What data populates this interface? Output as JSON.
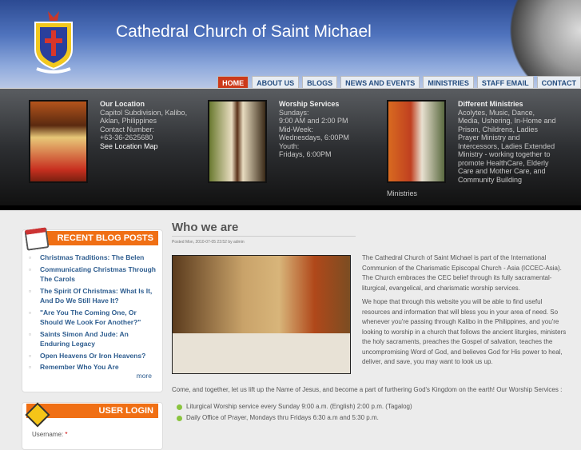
{
  "header": {
    "title": "Cathedral Church of Saint Michael"
  },
  "nav": [
    "HOME",
    "ABOUT US",
    "BLOGS",
    "NEWS AND EVENTS",
    "MINISTRIES",
    "STAFF EMAIL",
    "CONTACT"
  ],
  "features": [
    {
      "title": "Our Location",
      "lines": [
        "Capitol Subdivision, Kalibo, Aklan, Philippines",
        "Contact Number:",
        "+63-36-2625680"
      ],
      "link": "See Location Map"
    },
    {
      "title": "Worship Services",
      "lines": [
        "Sundays:",
        "9:00 AM and 2:00 PM",
        "Mid-Week:",
        "Wednesdays, 6:00PM",
        "Youth:",
        "Fridays, 6:00PM"
      ]
    },
    {
      "title": "Different Ministries",
      "lines": [
        "Acolytes, Music, Dance, Media, Ushering, In-Home and Prison, Childrens, Ladies Prayer Ministry and Intercessors, Ladies Extended Ministry - working together to promote HealthCare, Elderly Care and Mother Care, and Community Building"
      ],
      "tail": "Ministries"
    }
  ],
  "blog": {
    "title": "RECENT BLOG POSTS",
    "items": [
      "Christmas Traditions: The Belen",
      "Communicating Christmas Through The Carols",
      "The Spirit Of Christmas: What Is It, And Do We Still Have It?",
      "\"Are You The Coming One, Or Should We Look For Another?\"",
      "Saints Simon And Jude: An Enduring Legacy",
      "Open Heavens Or Iron Heavens?",
      "Remember Who You Are"
    ],
    "more": "more"
  },
  "login": {
    "title": "USER LOGIN",
    "username_label": "Username:",
    "required": "*"
  },
  "main": {
    "heading": "Who we are",
    "meta": "Posted Mon, 2010-07-05 23:52 by admin",
    "paragraphs": [
      "The Cathedral Church of Saint Michael is part of the International Communion of the Charismatic Episcopal Church - Asia (ICCEC-Asia). The Church embraces the CEC belief through its fully sacramental-liturgical, evangelical, and charismatic worship services.",
      "We hope that through this website you will be able to find useful resources and information that will bless you in your area of need. So whenever you're passing through Kalibo in the Philippines, and you're looking to worship in a church that follows the ancient liturgies, ministers the holy sacraments, preaches the Gospel of salvation, teaches the uncompromising Word of God, and believes God for His power to heal, deliver, and save, you may want to look us up."
    ],
    "come": "Come, and together, let us lift up the Name of Jesus, and become a part of furthering God's Kingdom on the earth! Our Worship Services :",
    "services": [
      "Liturgical Worship service every Sunday 9:00 a.m. (English) 2:00 p.m. (Tagalog)",
      "Daily Office of Prayer, Mondays thru Fridays 6:30 a.m and 5:30 p.m."
    ]
  }
}
